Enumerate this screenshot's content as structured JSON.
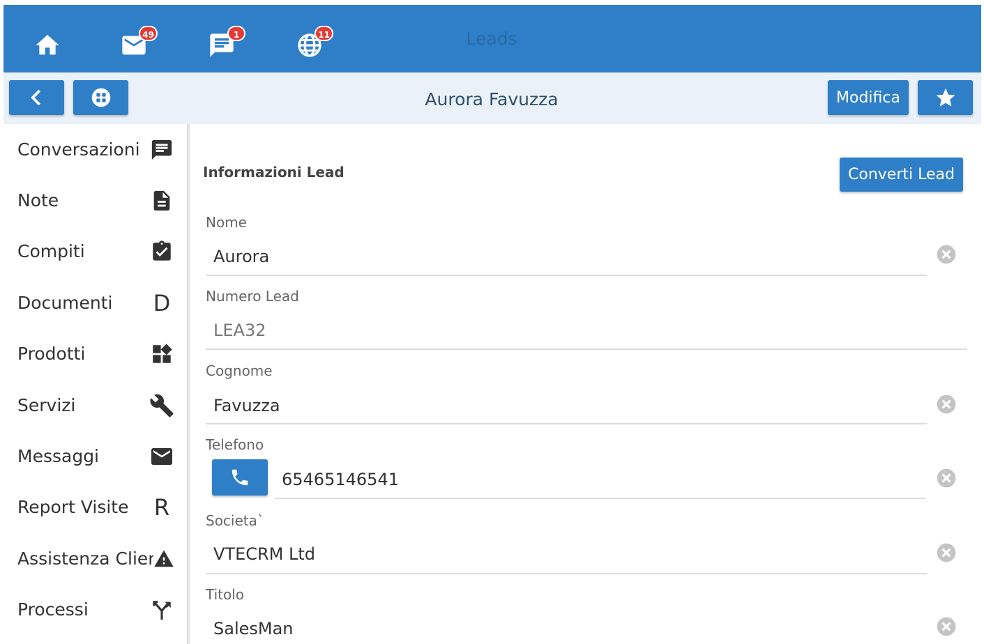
{
  "topbar": {
    "title": "Leads",
    "mail_badge": "49",
    "chat_badge": "1",
    "globe_badge": "11"
  },
  "subbar": {
    "title": "Aurora Favuzza",
    "edit_label": "Modifica"
  },
  "sidebar": {
    "items": [
      {
        "label": "Conversazioni",
        "icon": "chat-icon"
      },
      {
        "label": "Note",
        "icon": "note-icon"
      },
      {
        "label": "Compiti",
        "icon": "clipboard-check-icon"
      },
      {
        "label": "Documenti",
        "icon": "D"
      },
      {
        "label": "Prodotti",
        "icon": "widgets-icon"
      },
      {
        "label": "Servizi",
        "icon": "wrench-icon"
      },
      {
        "label": "Messaggi",
        "icon": "mail-icon"
      },
      {
        "label": "Report Visite",
        "icon": "R"
      },
      {
        "label": "Assistenza Clienti",
        "icon": "warning-icon"
      },
      {
        "label": "Processi",
        "icon": "fork-icon"
      }
    ]
  },
  "main": {
    "section_title": "Informazioni Lead",
    "convert_label": "Converti Lead",
    "fields": [
      {
        "label": "Nome",
        "value": "Aurora"
      },
      {
        "label": "Numero Lead",
        "value": "LEA32"
      },
      {
        "label": "Cognome",
        "value": "Favuzza"
      },
      {
        "label": "Telefono",
        "value": "65465146541"
      },
      {
        "label": "Societa`",
        "value": "VTECRM Ltd"
      },
      {
        "label": "Titolo",
        "value": "SalesMan"
      }
    ]
  },
  "colors": {
    "primary": "#2e7fc8",
    "subbar_bg": "#eaf1f8",
    "badge": "#e53935"
  }
}
